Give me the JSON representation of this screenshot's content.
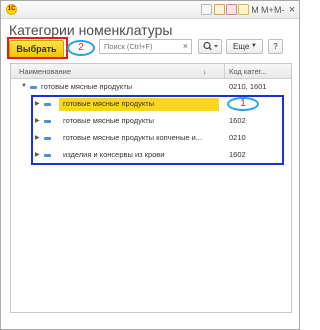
{
  "window": {
    "title": "Категории номенклатуры",
    "toolbar_letters": [
      "M",
      "M+",
      "M-"
    ],
    "close_glyph": "×"
  },
  "command_bar": {
    "select_label": "Выбрать",
    "search_placeholder": "Поиск (Ctrl+F)",
    "search_clear_glyph": "×",
    "more_label": "Еще",
    "help_label": "?"
  },
  "table": {
    "columns": [
      "Наименование",
      "Код катег..."
    ],
    "sort_glyph": "↓",
    "rows": [
      {
        "level": 0,
        "name": "готовые мясные продукты",
        "code": "0210, 1601",
        "expanded": true,
        "selected": false
      },
      {
        "level": 1,
        "name": "готовые мясные продукты",
        "code": "1",
        "expanded": false,
        "selected": true
      },
      {
        "level": 1,
        "name": "готовые мясные продукты",
        "code": "1602",
        "expanded": false,
        "selected": false
      },
      {
        "level": 1,
        "name": "готовые мясные продукты копченые и...",
        "code": "0210",
        "expanded": false,
        "selected": false
      },
      {
        "level": 1,
        "name": "изделия и консервы из крови",
        "code": "1602",
        "expanded": false,
        "selected": false
      }
    ]
  },
  "annotations": {
    "marker_one": "1",
    "marker_two": "2"
  },
  "colors": {
    "select_button": "#f5c400",
    "selected_row": "#fbd51e",
    "red_outline": "#e31b1b",
    "blue_outline": "#1a2fd6",
    "marker_outline": "#2aa0e6"
  }
}
